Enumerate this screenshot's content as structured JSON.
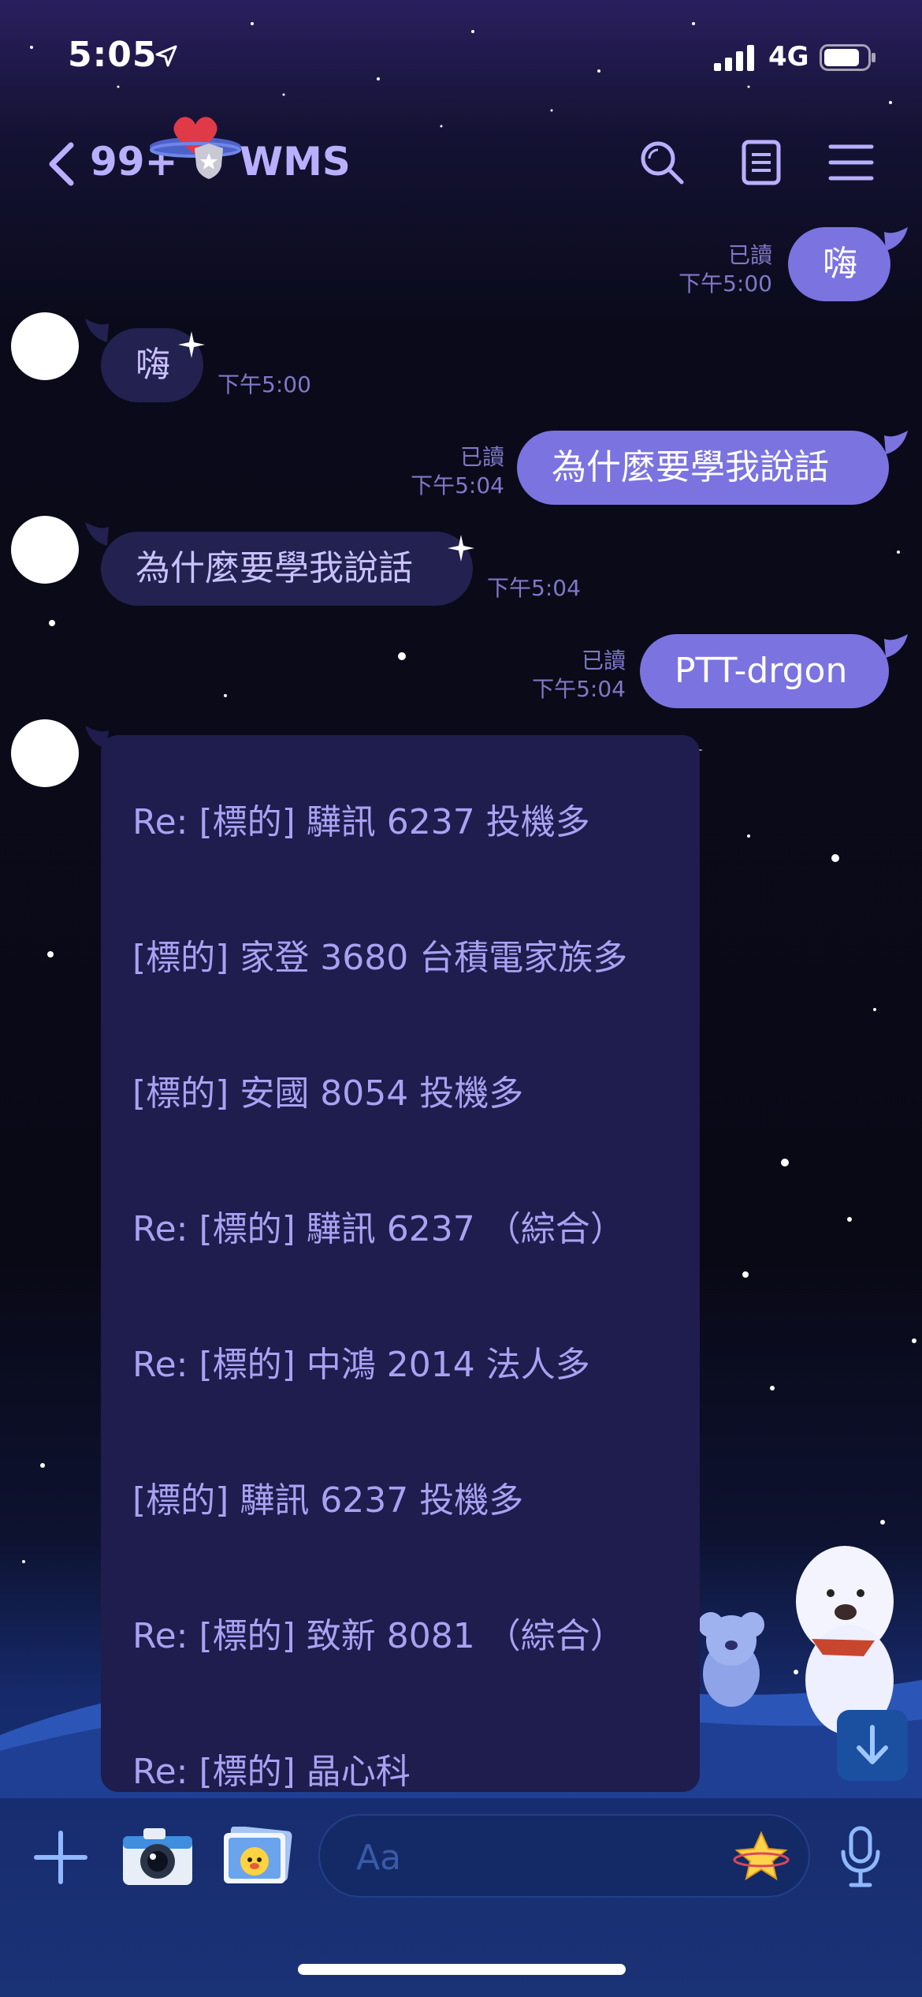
{
  "status_bar": {
    "time": "5:05",
    "network": "4G"
  },
  "header": {
    "unread_count": "99+",
    "chat_name": "WMS"
  },
  "messages": [
    {
      "side": "out",
      "text": "嗨",
      "read": "已讀",
      "time": "下午5:00"
    },
    {
      "side": "in",
      "text": "嗨",
      "time": "下午5:00"
    },
    {
      "side": "out",
      "text": "為什麼要學我說話",
      "read": "已讀",
      "time": "下午5:04"
    },
    {
      "side": "in",
      "text": "為什麼要學我說話",
      "time": "下午5:04"
    },
    {
      "side": "out",
      "text": "PTT-drgon",
      "read": "已讀",
      "time": "下午5:04"
    }
  ],
  "list_message": {
    "items": [
      "Re: [標的] 驊訊 6237 投機多",
      "[標的] 家登 3680 台積電家族多",
      "[標的] 安國 8054 投機多",
      "Re: [標的] 驊訊 6237 （綜合）",
      "Re: [標的] 中鴻 2014 法人多",
      "[標的] 驊訊 6237 投機多",
      "Re: [標的] 致新 8081 （綜合）",
      "Re: [標的] 晶心科"
    ]
  },
  "input_bar": {
    "placeholder": "Aa"
  },
  "colors": {
    "outgoing_bubble": "#7b73e0",
    "incoming_bubble": "#23214f",
    "accent": "#b8b0ff"
  }
}
